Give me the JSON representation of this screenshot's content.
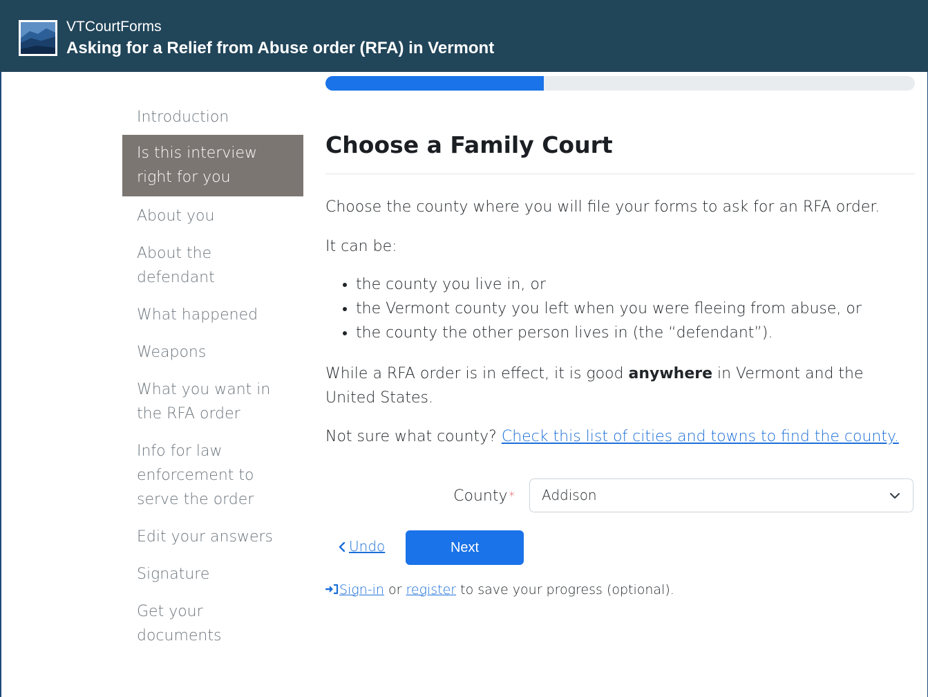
{
  "header": {
    "app_name": "VTCourtForms",
    "title": "Asking for a Relief from Abuse order (RFA) in Vermont",
    "background": "#214559"
  },
  "progress": {
    "percent": 37,
    "color": "#1a73e8"
  },
  "sidebar": {
    "items": [
      {
        "label": "Introduction",
        "active": false
      },
      {
        "label": "Is this interview right for you",
        "active": true
      },
      {
        "label": "About you",
        "active": false
      },
      {
        "label": "About the defendant",
        "active": false
      },
      {
        "label": "What happened",
        "active": false
      },
      {
        "label": "Weapons",
        "active": false
      },
      {
        "label": "What you want in the RFA order",
        "active": false
      },
      {
        "label": "Info for law enforcement to serve the order",
        "active": false
      },
      {
        "label": "Edit your answers",
        "active": false
      },
      {
        "label": "Signature",
        "active": false
      },
      {
        "label": "Get your documents",
        "active": false
      }
    ]
  },
  "main": {
    "title": "Choose a Family Court",
    "intro": "Choose the county where you will file your forms to ask for an RFA order.",
    "can_be": "It can be:",
    "options": [
      "the county you live in, or",
      "the Vermont county you left when you were fleeing from abuse, or",
      "the county the other person lives in (the “defendant”)."
    ],
    "effect_before": "While a RFA order is in effect, it is good ",
    "effect_bold": "anywhere",
    "effect_after": " in Vermont and the United States.",
    "not_sure": "Not sure what county?",
    "not_sure_link": "Check this list of cities and towns to find the county."
  },
  "form": {
    "county_label": "County",
    "required_mark": "*",
    "county_value": "Addison"
  },
  "actions": {
    "undo_label": "Undo",
    "next_label": "Next"
  },
  "signin": {
    "signin_link": "Sign-in",
    "or": " or ",
    "register_link": "register",
    "suffix": " to save your progress (optional)."
  }
}
